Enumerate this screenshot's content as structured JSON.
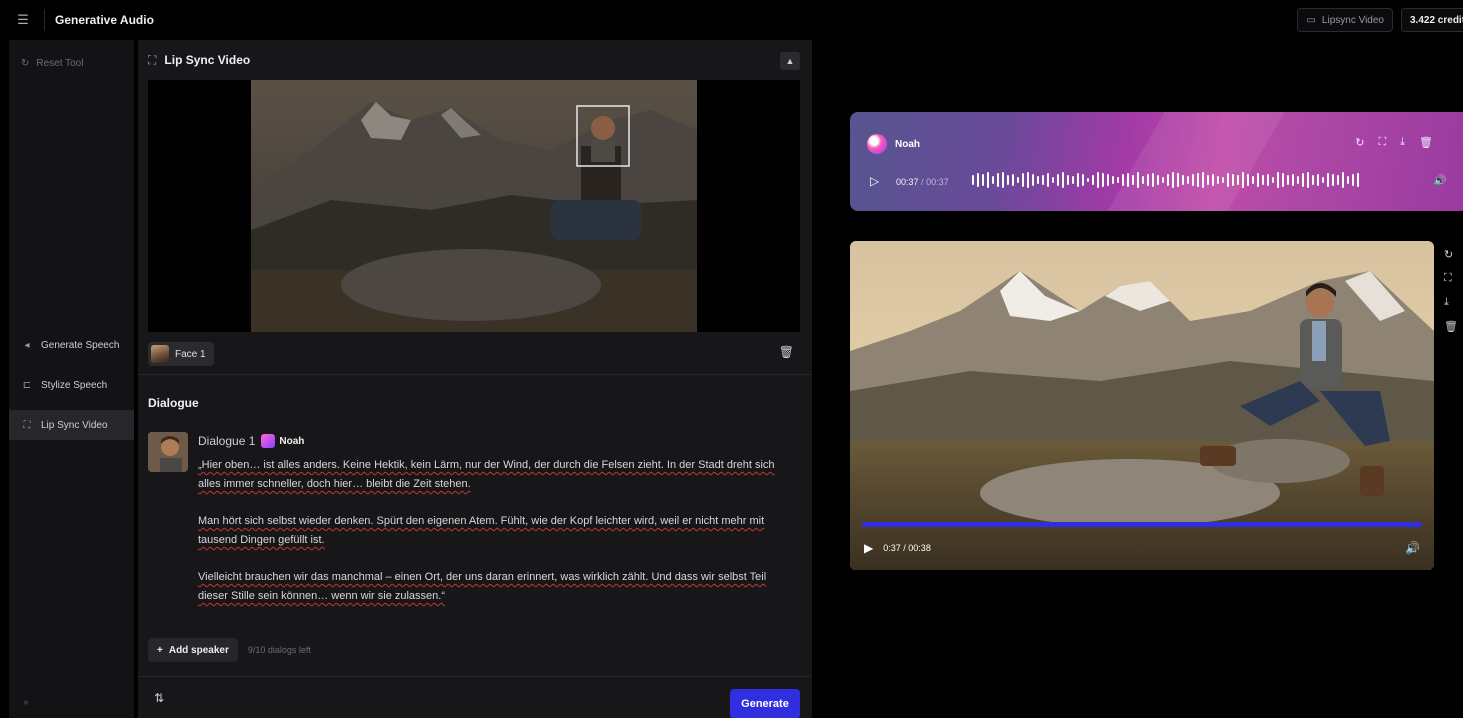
{
  "app": {
    "title": "Generative Audio"
  },
  "top_right": {
    "lipsync_label": "Lipsync Video",
    "credits": "3.422 credits"
  },
  "sidebar": {
    "reset_label": "Reset Tool",
    "items": [
      {
        "label": "Generate Speech",
        "icon": "waveform-icon"
      },
      {
        "label": "Stylize Speech",
        "icon": "stylize-icon"
      },
      {
        "label": "Lip Sync Video",
        "icon": "lipsync-icon",
        "active": true
      }
    ]
  },
  "panel": {
    "title": "Lip Sync Video",
    "face_label": "Face 1",
    "dialogue_heading": "Dialogue",
    "dialogue": {
      "label": "Dialogue 1",
      "speaker": "Noah",
      "paragraphs": [
        "„Hier oben… ist alles anders. Keine Hektik, kein Lärm, nur der Wind, der durch die Felsen zieht. In der Stadt dreht sich alles immer schneller, doch hier… bleibt die Zeit stehen.",
        "Man hört sich selbst wieder denken. Spürt den eigenen Atem. Fühlt, wie der Kopf leichter wird, weil er nicht mehr mit tausend Dingen gefüllt ist.",
        "Vielleicht brauchen wir das manchmal – einen Ort, der uns daran erinnert, was wirklich zählt. Und dass wir selbst Teil dieser Stille sein können… wenn wir sie zulassen.“"
      ]
    },
    "add_speaker_label": "Add speaker",
    "dialogs_left": "9/10 dialogs left",
    "generate_label": "Generate"
  },
  "audio": {
    "speaker": "Noah",
    "current": "00:37",
    "total": "00:37"
  },
  "video": {
    "current": "0:37",
    "total": "00:38",
    "progress": 1.0
  },
  "colors": {
    "accent": "#2f2fe0",
    "panel": "#17171a",
    "sidebar": "#131316"
  }
}
